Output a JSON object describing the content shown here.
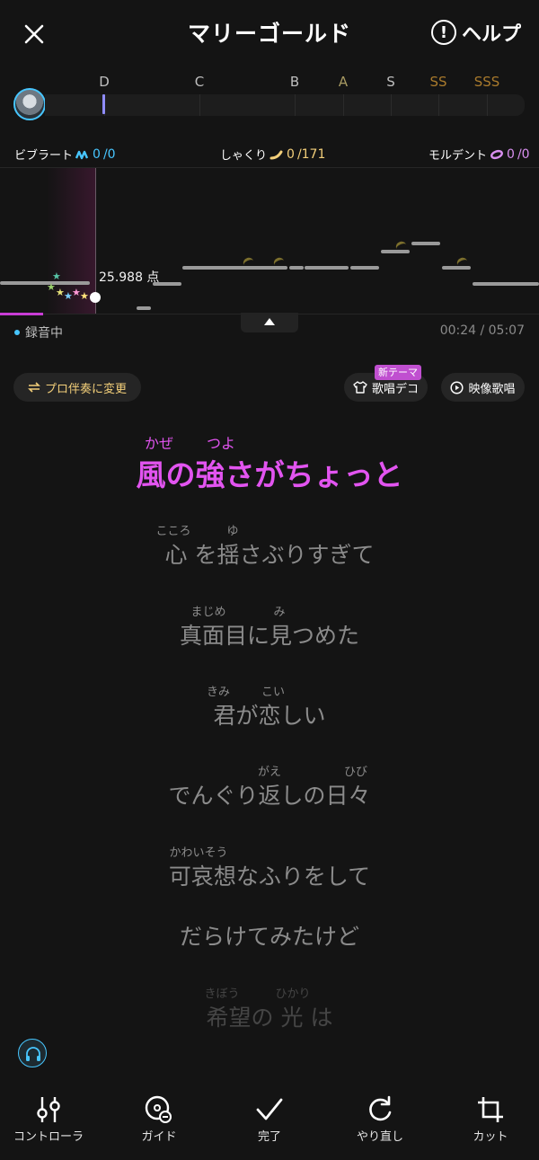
{
  "header": {
    "title": "マリーゴールド",
    "help_label": "ヘルプ"
  },
  "rank_bar": {
    "labels": [
      {
        "text": "D",
        "color": "#bfbfbf"
      },
      {
        "text": "C",
        "color": "#bfbfbf"
      },
      {
        "text": "B",
        "color": "#bfbfbf"
      },
      {
        "text": "A",
        "color": "#a89a62"
      },
      {
        "text": "S",
        "color": "#bfbfbf"
      },
      {
        "text": "SS",
        "color": "#a97a2c"
      },
      {
        "text": "SSS",
        "color": "#a97a2c"
      }
    ]
  },
  "counters": {
    "vibrato": {
      "label": "ビブラート",
      "current": "0",
      "total": "/0",
      "color": "#47c6ff"
    },
    "shakuri": {
      "label": "しゃくり",
      "current": "0",
      "total": "/171",
      "color": "#f3cf7a"
    },
    "mordent": {
      "label": "モルデント",
      "current": "0",
      "total": "/0",
      "color": "#d98ff0"
    }
  },
  "pitch": {
    "current_score": "25.988 点",
    "progress_fraction": 0.08
  },
  "status": {
    "recording": "録音中",
    "time": "00:24 / 05:07"
  },
  "actions": {
    "pro_label": "プロ伴奏に変更",
    "deco_label": "歌唱デコ",
    "new_badge": "新テーマ",
    "video_label": "映像歌唱"
  },
  "lyrics": [
    {
      "text": "風の強さがちょっと",
      "ruby": [
        "かぜ",
        "つよ"
      ],
      "state": "active"
    },
    {
      "text": "心 を揺さぶりすぎて",
      "ruby": [
        "こころ",
        "ゆ"
      ],
      "state": "normal"
    },
    {
      "text": "真面目に見つめた",
      "ruby": [
        "まじめ",
        "み"
      ],
      "state": "normal"
    },
    {
      "text": "君が恋しい",
      "ruby": [
        "きみ",
        "こい"
      ],
      "state": "normal"
    },
    {
      "text": "でんぐり返しの日々",
      "ruby": [
        "がえ",
        "ひび"
      ],
      "state": "normal"
    },
    {
      "text": "可哀想なふりをして",
      "ruby": [
        "かわいそう"
      ],
      "state": "normal"
    },
    {
      "text": "だらけてみたけど",
      "ruby": [],
      "state": "normal"
    },
    {
      "text": "希望の 光 は",
      "ruby": [
        "きぼう",
        "ひかり"
      ],
      "state": "fade"
    }
  ],
  "nav": {
    "controller": "コントローラ",
    "guide": "ガイド",
    "done": "完了",
    "redo": "やり直し",
    "cut": "カット"
  },
  "icons": {
    "close": "close-icon",
    "help": "help-icon",
    "headphone": "headphone-icon"
  }
}
